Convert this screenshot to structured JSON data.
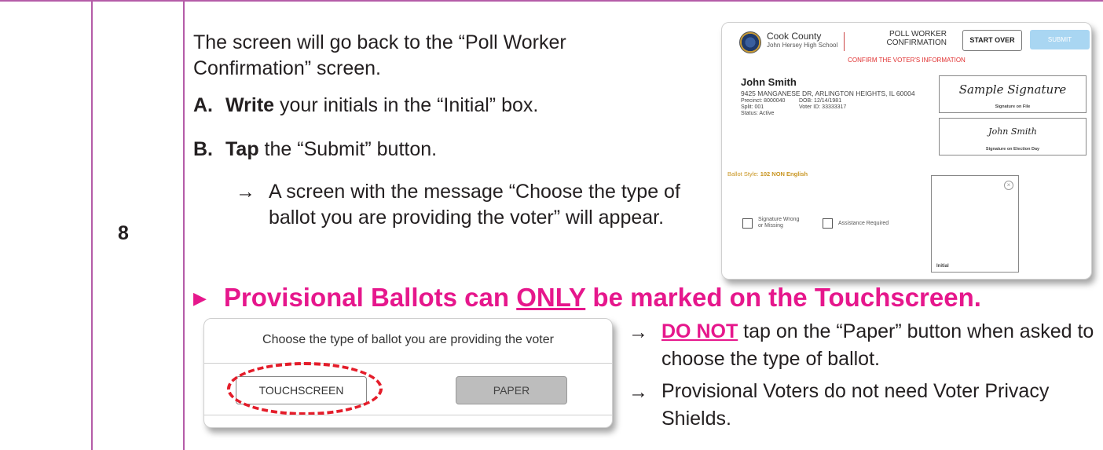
{
  "step": {
    "number": "8"
  },
  "instructions": {
    "intro": "The screen will go back to the “Poll Worker Confirmation” screen.",
    "step_a": {
      "letter": "A.",
      "verb": "Write",
      "rest": " your initials in the “Initial” box."
    },
    "step_b": {
      "letter": "B.",
      "verb": "Tap",
      "rest": " the “Submit” button."
    },
    "result": "A screen with the message “Choose the type of ballot you are providing the voter” will appear.",
    "arrow": "→"
  },
  "confirmation_screen": {
    "county": "Cook County",
    "school": "John Hersey High School",
    "title_line1": "POLL WORKER",
    "title_line2": "CONFIRMATION",
    "start_over": "START OVER",
    "submit": "SUBMIT",
    "confirm_heading": "CONFIRM THE VOTER'S INFORMATION",
    "voter_name": "John Smith",
    "address": "9425 MANGANESE DR, ARLINGTON HEIGHTS, IL 60004",
    "precinct": "Precinct: 8000040",
    "split": "Split: 001",
    "status": "Status: Active",
    "dob": "DOB: 12/14/1981",
    "voter_id": "Voter ID: 33333317",
    "sample_signature": "Sample Signature",
    "signature_on_file": "Signature on File",
    "election_signature": "John Smith",
    "signature_on_election_day": "Signature on Election Day",
    "ballot_style_label": "Ballot Style: ",
    "ballot_style_value": "102 NON English",
    "sig_wrong_line1": "Signature Wrong",
    "sig_wrong_line2": "or Missing",
    "assistance": "Assistance Required",
    "initial_label": "Initial",
    "close_symbol": "×",
    "colors": {
      "submit_bg": "#a9d6f2",
      "confirm_text": "#e03030",
      "ballot_style": "#c8941f"
    }
  },
  "warning": {
    "marker": "▶",
    "before": "Provisional Ballots can ",
    "emphasis": "ONLY",
    "after": " be marked on the Touchscreen.",
    "color": "#e6178c"
  },
  "ballot_choice_screen": {
    "title": "Choose the type of ballot you are providing the voter",
    "touchscreen": "TOUCHSCREEN",
    "paper": "PAPER",
    "highlight_color": "#e41d2a"
  },
  "notes": {
    "arrow": "→",
    "note1_emphasis": "DO NOT",
    "note1_rest": " tap on the “Paper” button when asked to choose the type of ballot.",
    "note2": "Provisional Voters do not need Voter Privacy Shields."
  }
}
